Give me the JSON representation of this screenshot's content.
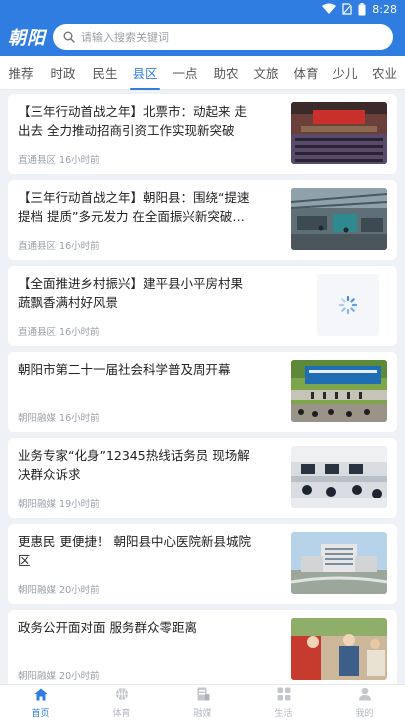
{
  "status": {
    "time": "8:28",
    "icons": [
      "wifi-icon",
      "sim-icon",
      "battery-icon"
    ]
  },
  "header": {
    "logo_text": "朝阳",
    "accent": "#2f7de1"
  },
  "search": {
    "placeholder": "请输入搜索关键词",
    "icon": "search-icon"
  },
  "tabs": [
    {
      "label": "推荐",
      "active": false
    },
    {
      "label": "时政",
      "active": false
    },
    {
      "label": "民生",
      "active": false
    },
    {
      "label": "县区",
      "active": true
    },
    {
      "label": "一点",
      "active": false
    },
    {
      "label": "助农",
      "active": false
    },
    {
      "label": "文旅",
      "active": false
    },
    {
      "label": "体育",
      "active": false
    },
    {
      "label": "少儿",
      "active": false
    },
    {
      "label": "农业",
      "active": false
    }
  ],
  "feed": [
    {
      "title": "【三年行动首战之年】北票市：动起来 走出去 全力推动招商引资工作实现新突破",
      "source": "直通县区",
      "time": "16小时前",
      "image": "conference-hall-photo"
    },
    {
      "title": "【三年行动首战之年】朝阳县：围绕“提速提档 提质”多元发力 在全面振兴新突破…",
      "source": "直通县区",
      "time": "16小时前",
      "image": "factory-workshop-photo"
    },
    {
      "title": "【全面推进乡村振兴】建平县小平房村果蔬飘香满村好风景",
      "source": "直通县区",
      "time": "16小时前",
      "image": "loading-spinner-icon"
    },
    {
      "title": "朝阳市第二十一届社会科学普及周开幕",
      "source": "朝阳融媒",
      "time": "16小时前",
      "image": "outdoor-ceremony-photo"
    },
    {
      "title": "业务专家“化身”12345热线话务员 现场解决群众诉求",
      "source": "朝阳融媒",
      "time": "19小时前",
      "image": "call-center-photo"
    },
    {
      "title": "更惠民 更便捷！ 朝阳县中心医院新县城院区",
      "source": "朝阳融媒",
      "time": "20小时前",
      "image": "hospital-building-photo"
    },
    {
      "title": "政务公开面对面 服务群众零距离",
      "source": "朝阳融媒",
      "time": "20小时前",
      "image": "public-service-photo"
    }
  ],
  "bottom_nav": [
    {
      "label": "首页",
      "icon": "home-icon",
      "active": true
    },
    {
      "label": "体育",
      "icon": "basketball-icon",
      "active": false
    },
    {
      "label": "融媒",
      "icon": "media-icon",
      "active": false
    },
    {
      "label": "生活",
      "icon": "grid-icon",
      "active": false
    },
    {
      "label": "我的",
      "icon": "user-icon",
      "active": false
    }
  ]
}
